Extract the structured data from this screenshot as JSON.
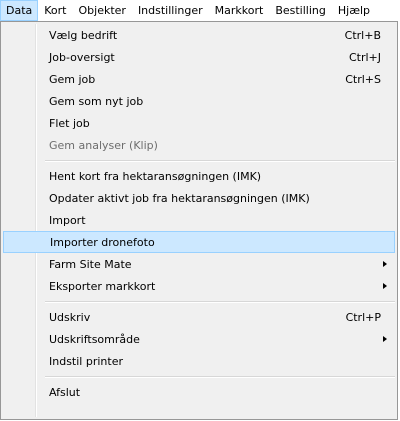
{
  "menubar": {
    "items": [
      "Data",
      "Kort",
      "Objekter",
      "Indstillinger",
      "Markkort",
      "Bestilling",
      "Hjælp"
    ]
  },
  "menu": {
    "items": [
      {
        "label": "Vælg bedrift",
        "shortcut": "Ctrl+B"
      },
      {
        "label": "Job-oversigt",
        "shortcut": "Ctrl+J"
      },
      {
        "label": "Gem job",
        "shortcut": "Ctrl+S"
      },
      {
        "label": "Gem som nyt job"
      },
      {
        "label": "Flet job"
      },
      {
        "label": "Gem analyser (Klip)",
        "disabled": true
      },
      {
        "label": "Hent kort fra hektaransøgningen (IMK)"
      },
      {
        "label": "Opdater aktivt job fra hektaransøgningen (IMK)"
      },
      {
        "label": "Import"
      },
      {
        "label": "Importer dronefoto",
        "highlighted": true
      },
      {
        "label": "Farm Site Mate",
        "submenu": true
      },
      {
        "label": "Eksporter markkort",
        "submenu": true
      },
      {
        "label": "Udskriv",
        "shortcut": "Ctrl+P"
      },
      {
        "label": "Udskriftsområde",
        "submenu": true
      },
      {
        "label": "Indstil printer"
      },
      {
        "label": "Afslut"
      }
    ]
  }
}
